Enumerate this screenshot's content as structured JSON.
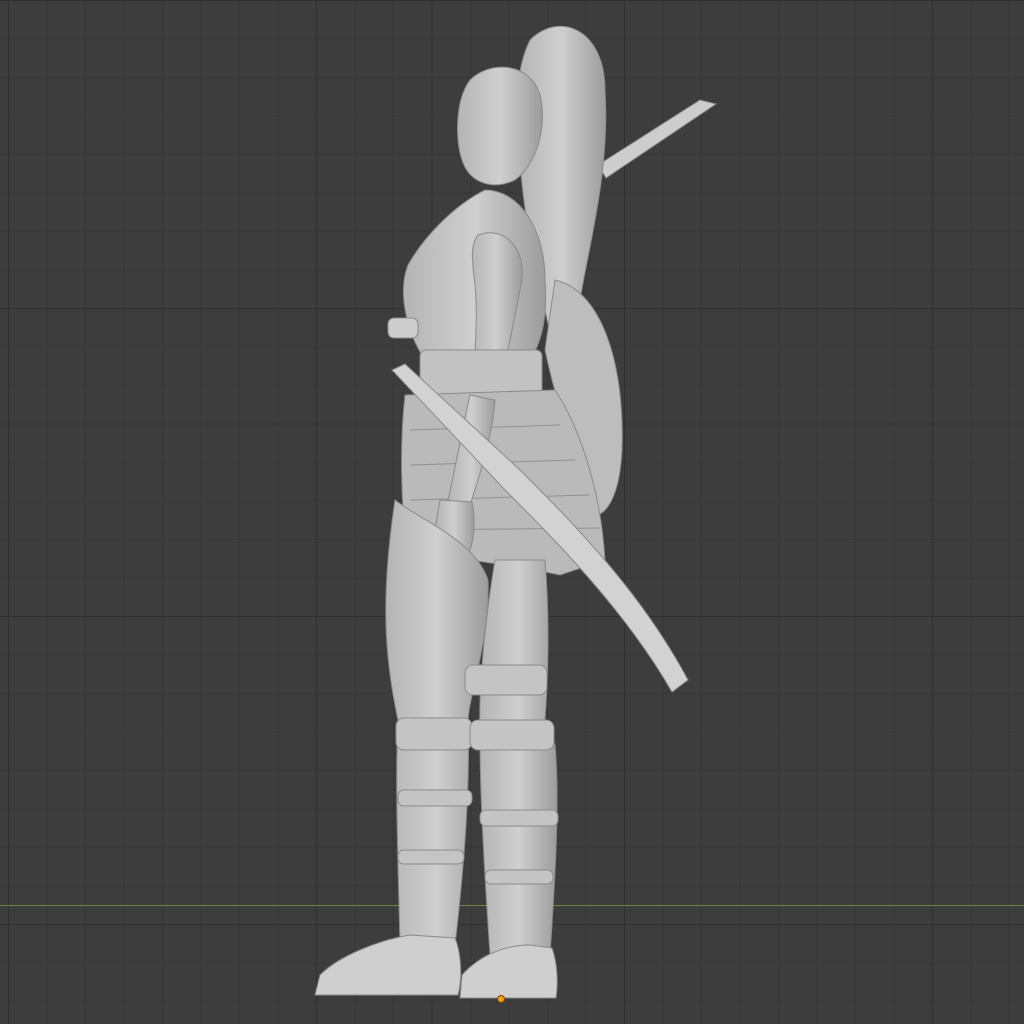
{
  "viewport": {
    "background_color": "#3d3d3d",
    "grid_minor_color": "#363636",
    "grid_major_color": "#2f2f2f",
    "floor_axis_color": "#6a8a3a",
    "origin_color": "#f0a020"
  },
  "model": {
    "shading_color": "#c8c8c8",
    "shadow_color": "#8e8e8e"
  }
}
